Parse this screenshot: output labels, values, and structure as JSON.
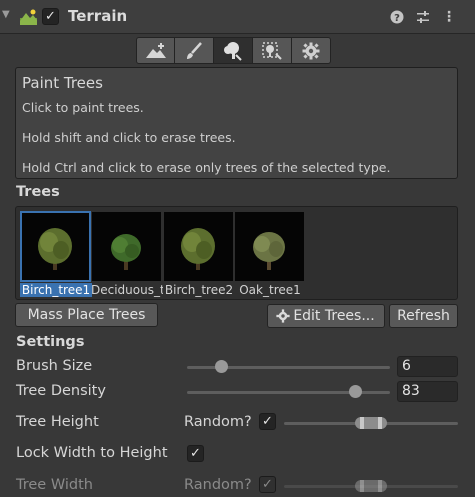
{
  "header": {
    "title": "Terrain",
    "enabled_check": "✓",
    "help_icon": "?",
    "preset_icon": "⇌",
    "menu_icon": "⋮",
    "fold_icon": "▼"
  },
  "toolbar": {
    "buttons": [
      "raise-terrain",
      "paint-texture",
      "paint-trees",
      "paint-details",
      "terrain-settings"
    ],
    "active_index": 2
  },
  "info": {
    "title": "Paint Trees",
    "lines": [
      "Click to paint trees.",
      "Hold shift and click to erase trees.",
      "Hold Ctrl and click to erase only trees of the selected type."
    ]
  },
  "trees": {
    "heading": "Trees",
    "items": [
      {
        "label": "Birch_tree1",
        "selected": true
      },
      {
        "label": "Deciduous_tree",
        "selected": false
      },
      {
        "label": "Birch_tree2",
        "selected": false
      },
      {
        "label": "Oak_tree1",
        "selected": false
      }
    ]
  },
  "buttons": {
    "mass_place": "Mass Place Trees",
    "edit_trees": "Edit Trees...",
    "refresh": "Refresh"
  },
  "settings": {
    "heading": "Settings",
    "brush_size_label": "Brush Size",
    "brush_size_value": "6",
    "brush_size_fraction": 0.17,
    "tree_density_label": "Tree Density",
    "tree_density_value": "83",
    "tree_density_fraction": 0.83,
    "tree_height_label": "Tree Height",
    "random_label": "Random?",
    "checkmark": "✓",
    "lock_width_label": "Lock Width to Height",
    "tree_width_label": "Tree Width"
  },
  "colors": {
    "background": "#383838",
    "selection": "#3a72b0",
    "field": "#2a2a2a"
  }
}
